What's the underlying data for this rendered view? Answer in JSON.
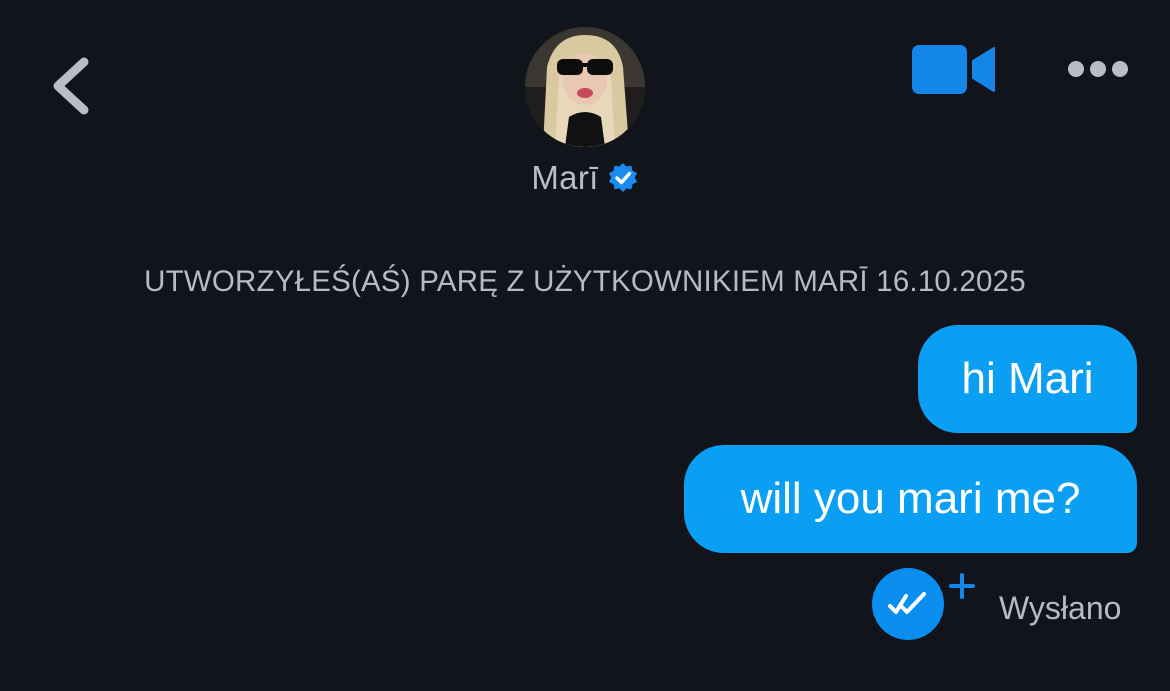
{
  "header": {
    "contact_name": "Marī",
    "icons": {
      "back": "chevron-left-icon",
      "verified": "verified-badge-icon",
      "video": "video-camera-icon",
      "more": "more-dots-icon"
    }
  },
  "system_message": "UTWORZYŁEŚ(AŚ) PARĘ Z UŻYTKOWNIKIEM MARĪ 16.10.2025",
  "messages": [
    {
      "text": "hi Mari",
      "direction": "outgoing"
    },
    {
      "text": "will you mari me?",
      "direction": "outgoing"
    }
  ],
  "status": {
    "label": "Wysłano",
    "icon": "double-check-icon",
    "plus_icon": "plus-icon"
  },
  "colors": {
    "background": "#11141b",
    "accent": "#0a9ff3",
    "muted_text": "#b6bac3"
  }
}
